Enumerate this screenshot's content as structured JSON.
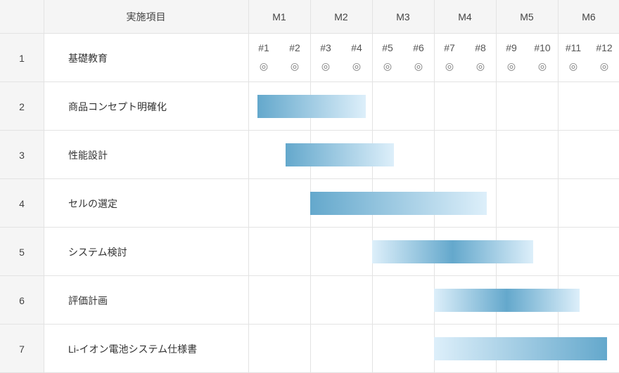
{
  "header": {
    "item_col": "実施項目",
    "months": [
      "M1",
      "M2",
      "M3",
      "M4",
      "M5",
      "M6"
    ]
  },
  "chart_data": {
    "type": "gantt",
    "x_unit": "session",
    "x_range": [
      0,
      12
    ],
    "sessions": [
      "#1",
      "#2",
      "#3",
      "#4",
      "#5",
      "#6",
      "#7",
      "#8",
      "#9",
      "#10",
      "#11",
      "#12"
    ],
    "session_mark": "◎",
    "tasks": [
      {
        "index": "1",
        "name": "基礎教育",
        "milestones": true
      },
      {
        "index": "2",
        "name": "商品コンセプト明確化",
        "start": 0.15,
        "end": 1.9,
        "fade": "right"
      },
      {
        "index": "3",
        "name": "性能設計",
        "start": 0.6,
        "end": 2.35,
        "fade": "right"
      },
      {
        "index": "4",
        "name": "セルの選定",
        "start": 1.0,
        "end": 3.85,
        "fade": "right"
      },
      {
        "index": "5",
        "name": "システム検討",
        "start": 2.0,
        "end": 4.6,
        "fade": "both"
      },
      {
        "index": "6",
        "name": "評価計画",
        "start": 3.0,
        "end": 5.35,
        "fade": "both"
      },
      {
        "index": "7",
        "name": "Li-イオン電池システム仕様書",
        "start": 3.0,
        "end": 5.8,
        "fade": "left"
      }
    ],
    "colors": {
      "bar_dark": "#64a8cc",
      "bar_light": "#ddeffa",
      "header_bg": "#f5f5f5",
      "grid": "#e3e3e3"
    }
  }
}
